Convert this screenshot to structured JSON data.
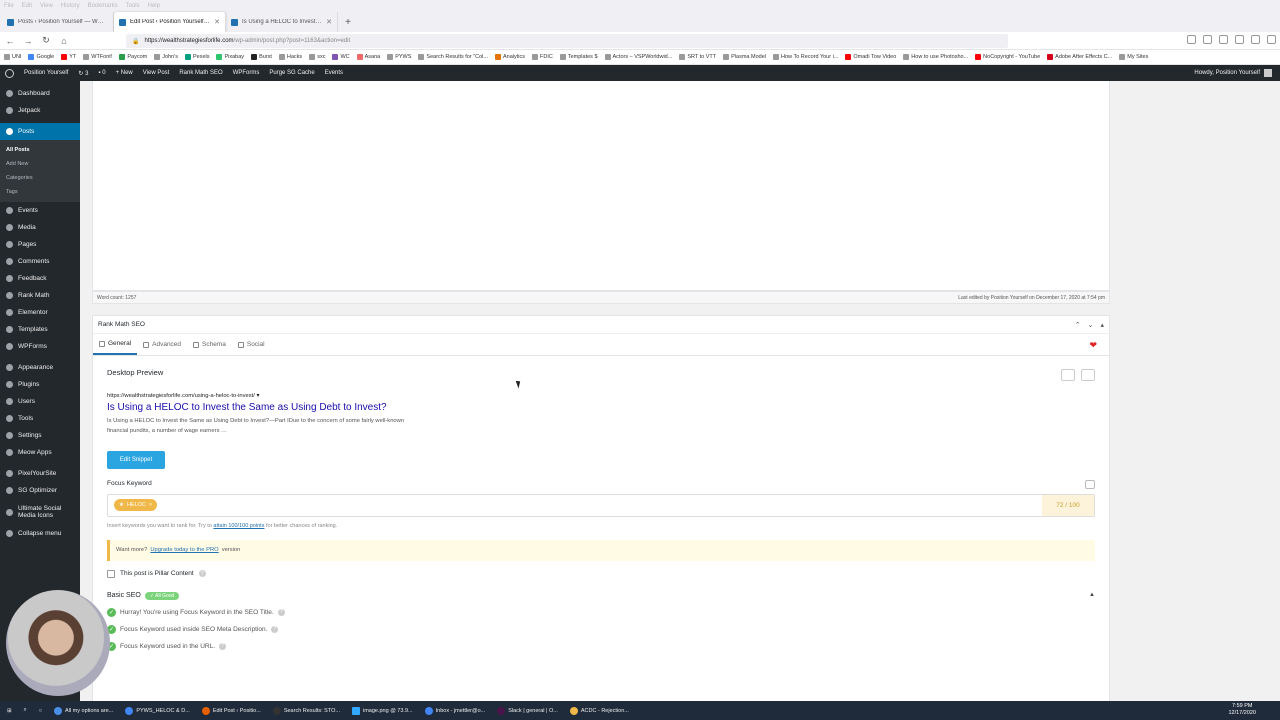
{
  "browser": {
    "menu": [
      "File",
      "Edit",
      "View",
      "History",
      "Bookmarks",
      "Tools",
      "Help"
    ],
    "tabs": [
      {
        "label": "Posts ‹ Position Yourself — W…"
      },
      {
        "label": "Edit Post ‹ Position Yourself…"
      },
      {
        "label": "Is Using a HELOC to Invest the…"
      }
    ],
    "url_domain": "https://wealthstrategiesforlife.com",
    "url_path": "/wp-admin/post.php?post=1163&action=edit",
    "bookmarks": [
      "UNI",
      "Google",
      "YT",
      "WTFont!",
      "Paycom",
      "John's",
      "Pexels",
      "Pixabay",
      "Burst",
      "Hacks",
      "sxc",
      "WC",
      "Asana",
      "PYWS",
      "Search Results for \"Col...",
      "Analytics",
      "FDIC",
      "Templates $",
      "Actors – VSPWorldwid...",
      "SRT to VTT",
      "Plasma Model",
      "How To Record Your i...",
      "Omadi Tow Video",
      "How to use Photosho...",
      "NoCopyright - YouTube",
      "Adobe After Effects C...",
      "My Sites"
    ]
  },
  "adminbar": {
    "site": "Position Yourself",
    "updates": "3",
    "comments": "0",
    "new": "New",
    "view_post": "View Post",
    "rank_math": "Rank Math SEO",
    "wpforms": "WPForms",
    "purge": "Purge SG Cache",
    "events": "Events",
    "howdy": "Howdy, Position Yourself"
  },
  "sidebar": {
    "items_top": [
      "Dashboard",
      "Jetpack"
    ],
    "current": "Posts",
    "submenu": [
      "All Posts",
      "Add New",
      "Categories",
      "Tags"
    ],
    "items": [
      "Events",
      "Media",
      "Pages",
      "Comments",
      "Feedback",
      "Rank Math",
      "Elementor",
      "Templates",
      "WPForms"
    ],
    "items2": [
      "Appearance",
      "Plugins",
      "Users",
      "Tools",
      "Settings",
      "Meow Apps"
    ],
    "items3": [
      "PixelYourSite",
      "SG Optimizer",
      "Ultimate Social Media Icons",
      "Collapse menu"
    ]
  },
  "editor": {
    "word_count": "Word count: 1257",
    "last_edited": "Last edited by Position Yourself on December 17, 2020 at 7:54 pm"
  },
  "rankmath": {
    "title": "Rank Math SEO",
    "tabs": [
      "General",
      "Advanced",
      "Schema",
      "Social"
    ],
    "desktop_preview": "Desktop Preview",
    "serp_url": "https://wealthstrategiesforlife.com/using-a-heloc-to-invest/ ▾",
    "serp_title": "Is Using a HELOC to Invest the Same as Using Debt to Invest?",
    "serp_desc": "Is Using a HELOC to Invest the Same as Using Debt to Invest?—Part IDue to the concern of some fairly well-known financial pundits, a number of wage earners …",
    "edit_snippet": "Edit Snippet",
    "focus_keyword_label": "Focus Keyword",
    "focus_keyword": "HELOC",
    "score": "72 / 100",
    "help_prefix": "Insert keywords you want to rank for. Try to",
    "help_link": "attain 100/100 points",
    "help_suffix": "for better chances of ranking.",
    "notice_prefix": "Want more?",
    "notice_link": "Upgrade today to the PRO",
    "notice_suffix": "version",
    "pillar": "This post is Pillar Content",
    "basic_seo": "Basic SEO",
    "basic_badge": "✓ All Good",
    "checks": [
      "Hurray! You're using Focus Keyword in the SEO Title.",
      "Focus Keyword used inside SEO Meta Description.",
      "Focus Keyword used in the URL."
    ]
  },
  "taskbar": {
    "items": [
      "All my options are...",
      "PYWS_HELOC & D...",
      "Edit Post ‹ Positio...",
      "Search Results: STO...",
      "image.png @ 73.9...",
      "Inbox - jmettler@o...",
      "Slack | general | O...",
      "ACDC - Rejection..."
    ],
    "time": "7:59 PM",
    "date": "12/17/2020"
  },
  "colors": {
    "wp_dark": "#23282d",
    "wp_blue": "#0073aa",
    "serp_title": "#1a0dab",
    "keyword_tag": "#f0b849",
    "check_green": "#58bb58"
  }
}
